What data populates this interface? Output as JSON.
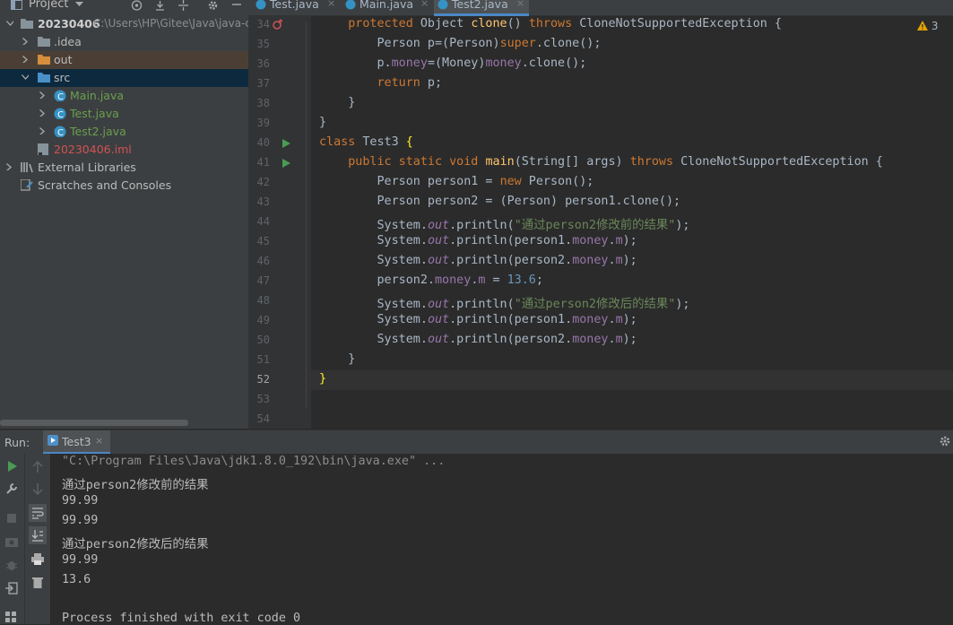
{
  "project_panel": {
    "title": "Project",
    "root_name": "20230406",
    "root_path": "C:\\Users\\HP\\Gitee\\Java\\java-c",
    "items": [
      {
        "label": ".idea"
      },
      {
        "label": "out"
      },
      {
        "label": "src"
      },
      {
        "label": "Main.java"
      },
      {
        "label": "Test.java"
      },
      {
        "label": "Test2.java"
      },
      {
        "label": "20230406.iml"
      },
      {
        "label": "External Libraries"
      },
      {
        "label": "Scratches and Consoles"
      }
    ]
  },
  "editor": {
    "tabs": [
      {
        "label": "Test.java"
      },
      {
        "label": "Main.java"
      },
      {
        "label": "Test2.java"
      }
    ],
    "close_glyph": "×",
    "warnings": "3",
    "line_numbers": [
      "34",
      "35",
      "36",
      "37",
      "38",
      "39",
      "40",
      "41",
      "42",
      "43",
      "44",
      "45",
      "46",
      "47",
      "48",
      "49",
      "50",
      "51",
      "52",
      "53",
      "54"
    ],
    "code": {
      "l34": {
        "kw1": "protected",
        "t1": " Object ",
        "fn": "clone",
        "t2": "() ",
        "kw2": "throws",
        "t3": " CloneNotSupportedException {"
      },
      "l35": {
        "t1": "Person p=(Person)",
        "kw": "super",
        "t2": ".clone();"
      },
      "l36": {
        "t1": "p.",
        "fld": "money",
        "t2": "=(Money)",
        "fld2": "money",
        "t3": ".clone();"
      },
      "l37": {
        "kw": "return",
        "t1": " p;"
      },
      "l38": {
        "t1": "}"
      },
      "l39": {
        "t1": "}"
      },
      "l40": {
        "kw": "class",
        "t1": " Test3 ",
        "brace": "{"
      },
      "l41": {
        "kw1": "public static void",
        "t0": " ",
        "fn": "main",
        "t1": "(String[] args) ",
        "kw2": "throws",
        "t2": " CloneNotSupportedException {"
      },
      "l42": {
        "t1": "Person person1 = ",
        "kw": "new",
        "t2": " Person();"
      },
      "l43": {
        "t1": "Person person2 = (Person) person1.clone();"
      },
      "l44": {
        "t1": "System.",
        "st": "out",
        "t2": ".println(",
        "str": "\"通过person2修改前的结果\"",
        "t3": ");"
      },
      "l45": {
        "t1": "System.",
        "st": "out",
        "t2": ".println(person1.",
        "fld": "money",
        "t3": ".",
        "fld2": "m",
        "t4": ");"
      },
      "l46": {
        "t1": "System.",
        "st": "out",
        "t2": ".println(person2.",
        "fld": "money",
        "t3": ".",
        "fld2": "m",
        "t4": ");"
      },
      "l47": {
        "t1": "person2.",
        "fld": "money",
        "t2": ".",
        "fld2": "m",
        "t3": " = ",
        "num": "13.6",
        "t4": ";"
      },
      "l48": {
        "t1": "System.",
        "st": "out",
        "t2": ".println(",
        "str": "\"通过person2修改后的结果\"",
        "t3": ");"
      },
      "l49": {
        "t1": "System.",
        "st": "out",
        "t2": ".println(person1.",
        "fld": "money",
        "t3": ".",
        "fld2": "m",
        "t4": ");"
      },
      "l50": {
        "t1": "System.",
        "st": "out",
        "t2": ".println(person2.",
        "fld": "money",
        "t3": ".",
        "fld2": "m",
        "t4": ");"
      },
      "l51": {
        "t1": "}"
      },
      "l52": {
        "brace": "}"
      }
    }
  },
  "run_panel": {
    "label": "Run:",
    "tab": "Test3",
    "console": [
      "\"C:\\Program Files\\Java\\jdk1.8.0_192\\bin\\java.exe\" ...",
      "通过person2修改前的结果",
      "99.99",
      "99.99",
      "通过person2修改后的结果",
      "99.99",
      "13.6",
      "Process finished with exit code 0"
    ]
  },
  "colors": {
    "keyword": "#cc7832",
    "string": "#6a8759",
    "field": "#9876aa",
    "number": "#6897bb",
    "function": "#ffc66d"
  }
}
